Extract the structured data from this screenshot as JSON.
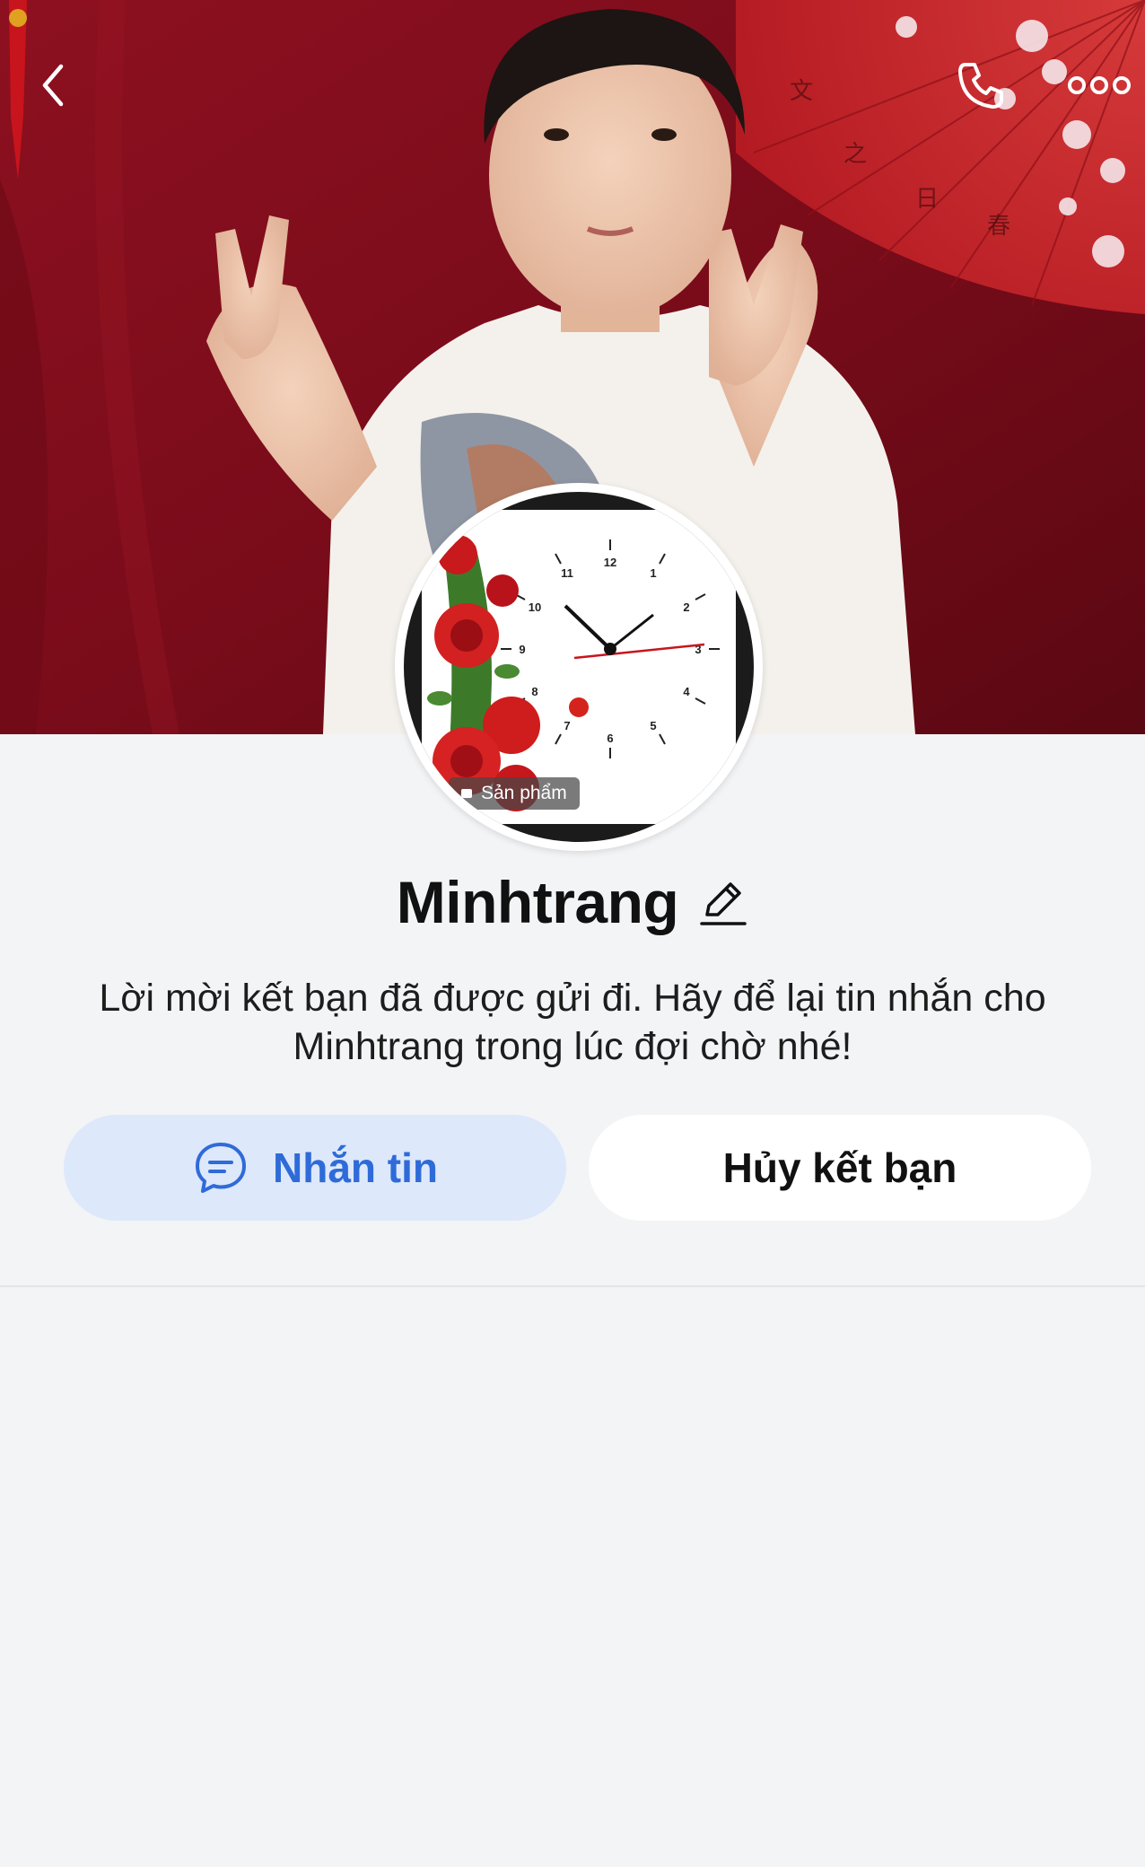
{
  "header": {
    "back_icon": "chevron-left-icon",
    "call_icon": "phone-icon",
    "more_icon": "more-dots-icon"
  },
  "avatar": {
    "badge_label": "Sản phẩm"
  },
  "profile": {
    "name": "Minhtrang",
    "edit_icon": "pencil-icon",
    "status_message": "Lời mời kết bạn đã được gửi đi. Hãy để lại tin nhắn cho Minhtrang trong lúc đợi chờ nhé!"
  },
  "actions": {
    "message_label": "Nhắn tin",
    "message_icon": "chat-bubble-icon",
    "unfriend_label": "Hủy kết bạn"
  },
  "colors": {
    "background": "#f3f4f6",
    "accent": "#2f6bd8",
    "accent_bg": "#dde8fb",
    "cover_red": "#8a1422"
  }
}
